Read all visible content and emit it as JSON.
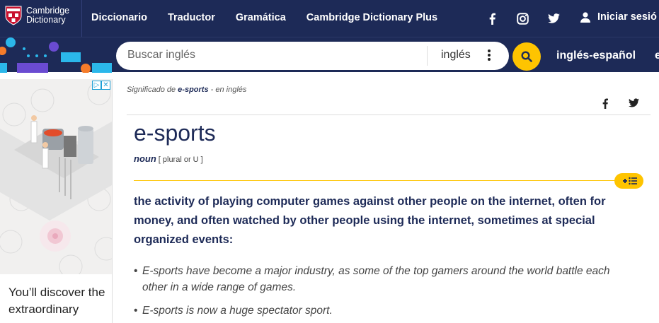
{
  "header": {
    "logo_line1": "Cambridge",
    "logo_line2": "Dictionary",
    "nav": [
      "Diccionario",
      "Traductor",
      "Gramática",
      "Cambridge Dictionary Plus"
    ],
    "login": "Iniciar sesió",
    "social_icons": [
      "facebook-icon",
      "instagram-icon",
      "twitter-icon"
    ]
  },
  "search": {
    "placeholder": "Buscar inglés",
    "language": "inglés",
    "dictionary": "inglés-español",
    "dictionary_next": "e"
  },
  "ad": {
    "text": "You’ll discover the extraordinary measures"
  },
  "entry": {
    "breadcrumb_prefix": "Significado de ",
    "breadcrumb_word": "e-sports",
    "breadcrumb_suffix": " - en inglés",
    "headword": "e-sports",
    "pos": "noun",
    "grammar": "[ plural or U ]",
    "definition": "the activity of playing computer games against other people on the internet, often for money, and often watched by other people using the internet, sometimes at special organized events:",
    "examples": [
      "E-sports have become a major industry, as some of the top gamers around the world battle each other in a wide range of games.",
      "E-sports is now a huge spectator sport."
    ]
  },
  "colors": {
    "navy": "#1d2a57",
    "yellow": "#fec400",
    "text": "#444444"
  }
}
